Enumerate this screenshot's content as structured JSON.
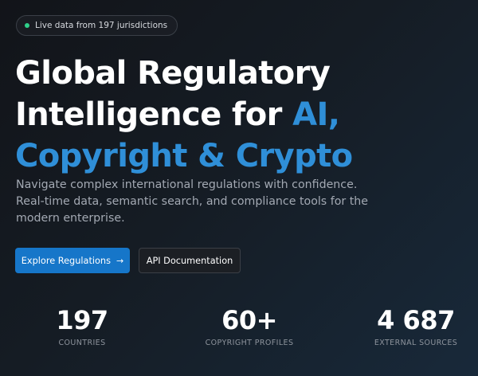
{
  "badge": {
    "text": "Live data from 197 jurisdictions"
  },
  "hero": {
    "title_line1": "Global Regulatory",
    "title_line2_prefix": "Intelligence for ",
    "title_line2_accent": "AI,",
    "title_line3_accent": "Copyright & Crypto",
    "subtitle": "Navigate complex international regulations with confidence. Real-time data, semantic search, and compliance tools for the modern enterprise."
  },
  "buttons": {
    "primary_label": "Explore Regulations",
    "primary_arrow": "→",
    "secondary_label": "API Documentation"
  },
  "stats": [
    {
      "value": "197",
      "label": "COUNTRIES"
    },
    {
      "value": "60+",
      "label": "COPYRIGHT PROFILES"
    },
    {
      "value": "4 687",
      "label": "EXTERNAL SOURCES"
    }
  ],
  "colors": {
    "accent": "#2f8fd8",
    "primary_button": "#1676c9",
    "live_dot": "#2fd08a"
  }
}
